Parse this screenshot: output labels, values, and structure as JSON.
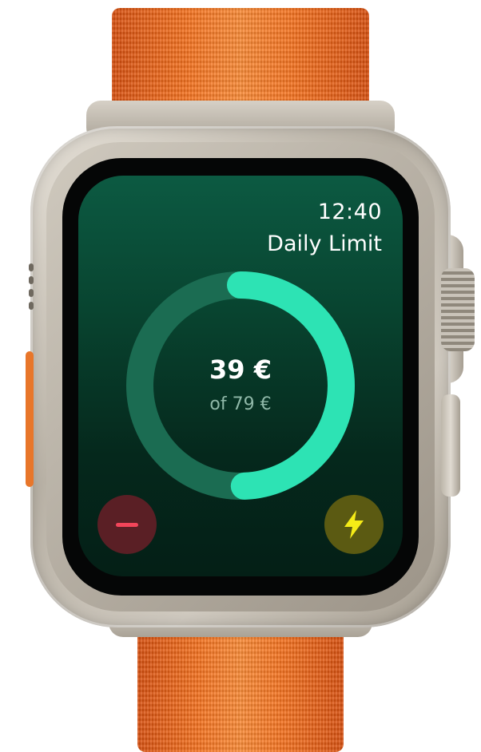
{
  "status_bar": {
    "time": "12:40"
  },
  "screen": {
    "title": "Daily Limit",
    "spent_label": "39 €",
    "limit_label": "of 79 €",
    "progress": {
      "spent": 39,
      "limit": 79
    }
  },
  "actions": {
    "decrease": {
      "icon": "minus-icon",
      "color": "#f2455a"
    },
    "boost": {
      "icon": "lightning-bolt-icon",
      "color": "#f5eb17"
    }
  },
  "colors": {
    "band": "#f4721f",
    "screen_background": "#08432f",
    "ring_track": "#1b6c52",
    "ring_progress": "#2de3b4"
  }
}
